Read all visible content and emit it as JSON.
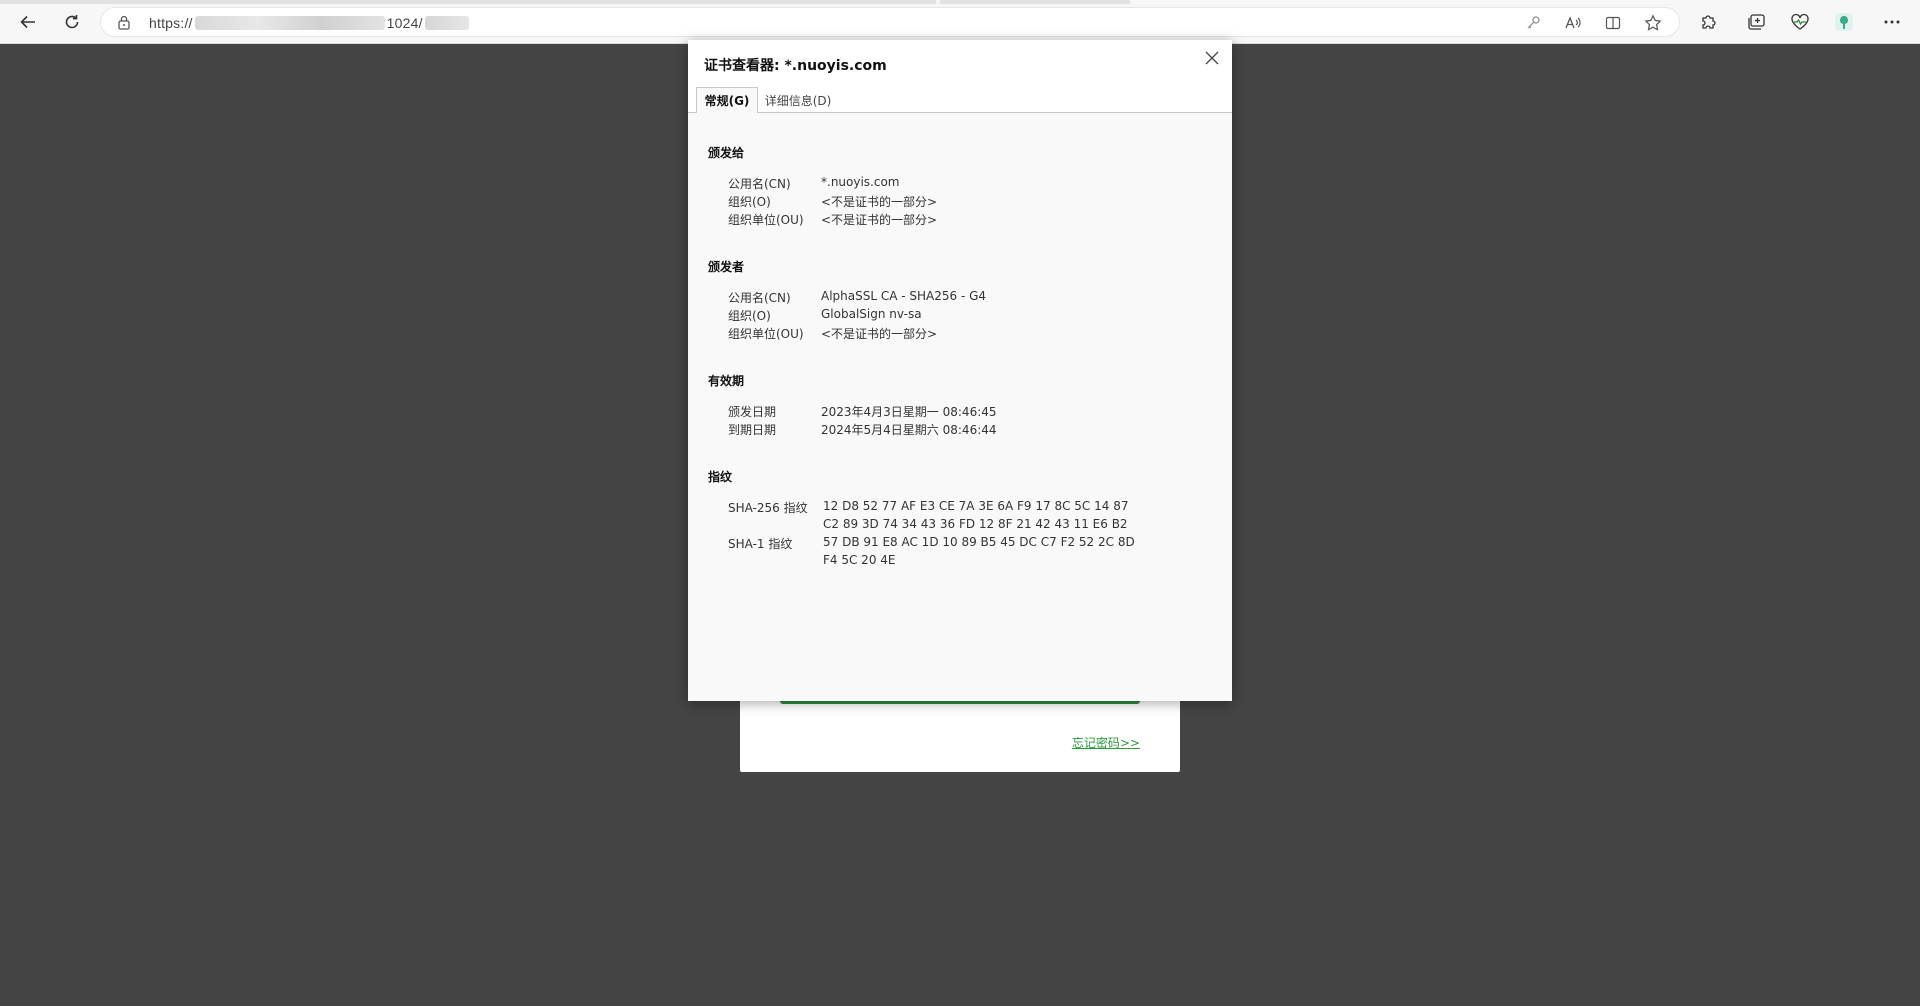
{
  "browser": {
    "url_prefix": "https://",
    "url_port": "1024/",
    "icons": {
      "back": "back-arrow-icon",
      "refresh": "refresh-icon",
      "lock": "lock-icon",
      "key": "key-icon",
      "read_aloud": "read-aloud-icon",
      "split": "split-screen-icon",
      "favorite": "star-icon",
      "extensions": "puzzle-icon",
      "collections": "collections-icon",
      "browser_essentials": "heart-pulse-icon",
      "profile": "profile-avatar-icon",
      "more": "more-dots-icon"
    }
  },
  "dialog": {
    "title": "证书查看器: *.nuoyis.com",
    "tabs": [
      {
        "label": "常规(G)",
        "active": true
      },
      {
        "label": "详细信息(D)",
        "active": false
      }
    ],
    "issued_to": {
      "heading": "颁发给",
      "rows": [
        {
          "label": "公用名(CN)",
          "value": "*.nuoyis.com"
        },
        {
          "label": "组织(O)",
          "value": "<不是证书的一部分>"
        },
        {
          "label": "组织单位(OU)",
          "value": "<不是证书的一部分>"
        }
      ]
    },
    "issued_by": {
      "heading": "颁发者",
      "rows": [
        {
          "label": "公用名(CN)",
          "value": "AlphaSSL CA - SHA256 - G4"
        },
        {
          "label": "组织(O)",
          "value": "GlobalSign nv-sa"
        },
        {
          "label": "组织单位(OU)",
          "value": "<不是证书的一部分>"
        }
      ]
    },
    "validity": {
      "heading": "有效期",
      "rows": [
        {
          "label": "颁发日期",
          "value": "2023年4月3日星期一 08:46:45"
        },
        {
          "label": "到期日期",
          "value": "2024年5月4日星期六 08:46:44"
        }
      ]
    },
    "fingerprints": {
      "heading": "指纹",
      "sha256_label": "SHA-256 指纹",
      "sha256_line1": "12 D8 52 77 AF E3 CE 7A 3E 6A F9 17 8C 5C 14 87",
      "sha256_line2": "C2 89 3D 74 34 43 36 FD 12 8F 21 42 43 11 E6 B2",
      "sha1_label": "SHA-1 指纹",
      "sha1_line1": "57 DB 91 E8 AC 1D 10 89 B5 45 DC C7 F2 52 2C 8D",
      "sha1_line2": "F4 5C 20 4E"
    }
  },
  "page": {
    "forgot_password": "忘记密码>>"
  },
  "colors": {
    "overlay": "#444444",
    "link_green": "#2a9a3e",
    "button_green": "#2e8b3c"
  }
}
